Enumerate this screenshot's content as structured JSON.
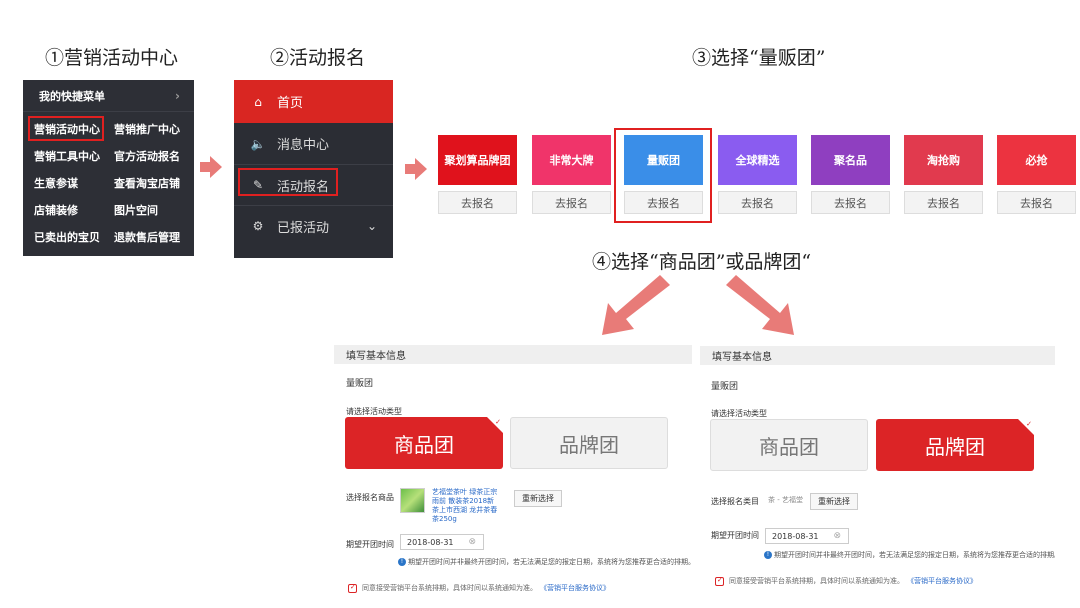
{
  "steps": {
    "s1": "①营销活动中心",
    "s2": "②活动报名",
    "s3": "③选择“量贩团”",
    "s4": "④选择“商品团”或品牌团“"
  },
  "panel1": {
    "header": "我的快捷菜单",
    "header_chevron": "›",
    "items": [
      "营销活动中心",
      "营销推广中心",
      "营销工具中心",
      "官方活动报名",
      "生意参谋",
      "查看淘宝店铺",
      "店铺装修",
      "图片空间",
      "已卖出的宝贝",
      "退款售后管理"
    ]
  },
  "panel2": {
    "items": [
      {
        "icon": "⌂",
        "label": "首页"
      },
      {
        "icon": "🔈",
        "label": "消息中心"
      },
      {
        "icon": "✎",
        "label": "活动报名"
      },
      {
        "icon": "⚙",
        "label": "已报活动",
        "dropdown": "⌄"
      }
    ]
  },
  "panel3": {
    "tiles": [
      {
        "label": "聚划算品牌团",
        "color": "#e0121c"
      },
      {
        "label": "非常大牌",
        "color": "#f0346a"
      },
      {
        "label": "量贩团",
        "color": "#3a8ee8"
      },
      {
        "label": "全球精选",
        "color": "#8a5cf0"
      },
      {
        "label": "聚名品",
        "color": "#8f3fc0"
      },
      {
        "label": "淘抢购",
        "color": "#e13a4e"
      },
      {
        "label": "必抢",
        "color": "#ec3340"
      }
    ],
    "register_label": "去报名"
  },
  "forms": {
    "header": "填写基本信息",
    "subtitle": "量贩团",
    "type_label": "请选择活动类型",
    "goods_group": "商品团",
    "brand_group": "品牌团",
    "left": {
      "select_label": "选择报名商品",
      "product_text": "艺福堂茶叶 绿茶正宗雨前 散装茶2018新茶上市西湖 龙井茶春茶250g",
      "reselect": "重新选择",
      "date_label": "期望开团时间",
      "date_value": "2018-08-31",
      "note": "期望开团时间并非最终开团时间，若无法满足您的报定日期，系统将为您推荐更合适的排期。",
      "agree_text": "同意接受营销平台系统排期，具体时间以系统通知为准。",
      "agree_link": "《营销平台服务协议》"
    },
    "right": {
      "select_label": "选择报名类目",
      "category_value": "茶 - 艺福堂",
      "reselect": "重新选择",
      "date_label": "期望开团时间",
      "date_value": "2018-08-31",
      "note": "期望开团时间并非最终开团时间，若无法满足您的报定日期，系统将为您推荐更合适的排期。",
      "agree_text": "同意接受营销平台系统排期，具体时间以系统通知为准。",
      "agree_link": "《营销平台服务协议》"
    }
  },
  "colors": {
    "highlight": "#e02020",
    "arrow": "#e87b78",
    "selected_card": "#dc2426"
  }
}
